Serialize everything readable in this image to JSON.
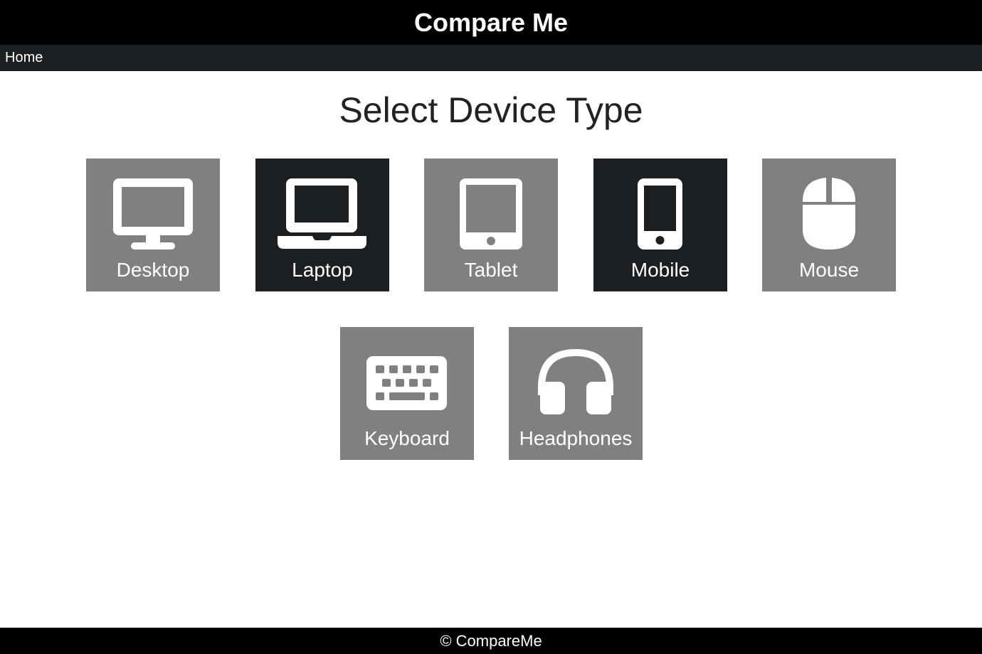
{
  "header": {
    "title": "Compare Me"
  },
  "nav": {
    "home_label": "Home"
  },
  "main": {
    "heading": "Select Device Type",
    "devices": [
      {
        "label": "Desktop",
        "icon": "desktop-icon",
        "color": "#808080"
      },
      {
        "label": "Laptop",
        "icon": "laptop-icon",
        "color": "#1c1f22"
      },
      {
        "label": "Tablet",
        "icon": "tablet-icon",
        "color": "#808080"
      },
      {
        "label": "Mobile",
        "icon": "mobile-icon",
        "color": "#1c1f22"
      },
      {
        "label": "Mouse",
        "icon": "mouse-icon",
        "color": "#808080"
      },
      {
        "label": "Keyboard",
        "icon": "keyboard-icon",
        "color": "#808080"
      },
      {
        "label": "Headphones",
        "icon": "headphones-icon",
        "color": "#808080"
      }
    ]
  },
  "footer": {
    "text": "© CompareMe"
  }
}
